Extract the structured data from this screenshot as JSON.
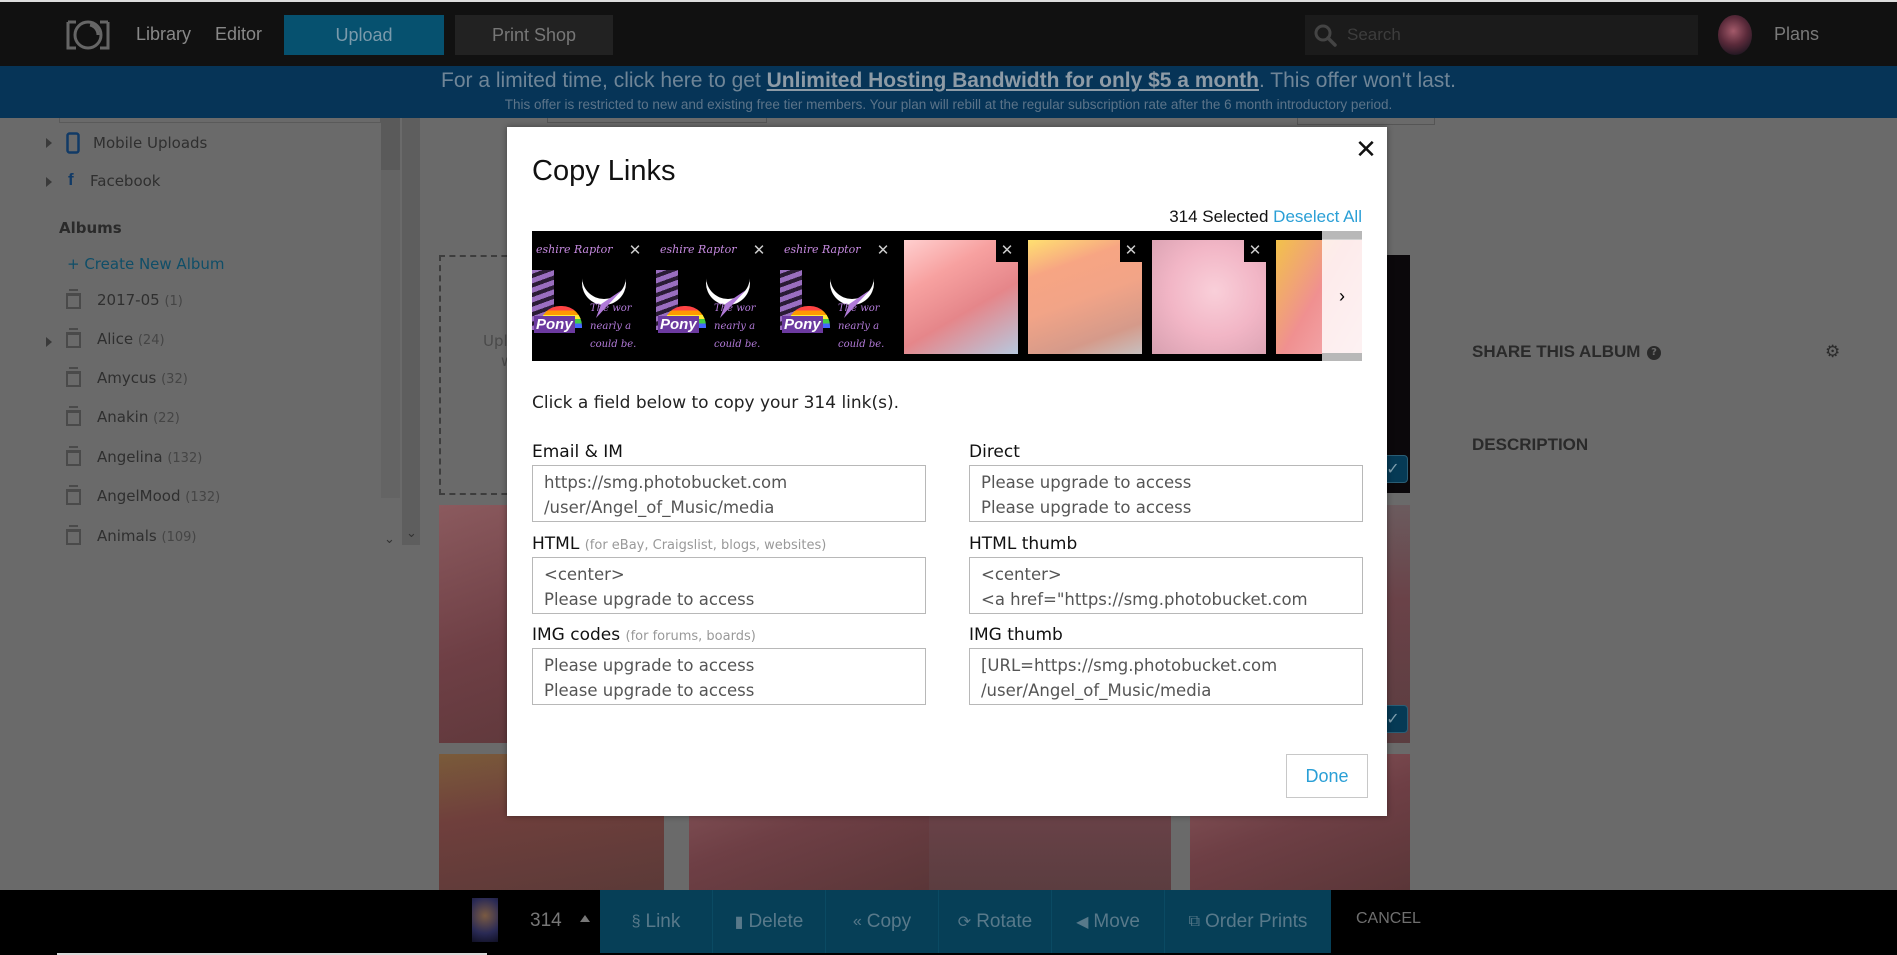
{
  "topnav": {
    "library": "Library",
    "editor": "Editor",
    "upload": "Upload",
    "print_shop": "Print Shop",
    "search_placeholder": "Search",
    "plans": "Plans"
  },
  "banner": {
    "prefix": "For a limited time, click here to get ",
    "link": "Unlimited Hosting Bandwidth for only $5 a month",
    "suffix": ". This offer won't last.",
    "sub": "This offer is restricted to new and existing free tier members. Your plan will rebill at the regular subscription rate after the 6 month introductory period."
  },
  "sidebar": {
    "sources": [
      {
        "label": "Mobile Uploads",
        "icon": "mobile-icon"
      },
      {
        "label": "Facebook",
        "icon": "facebook-icon"
      }
    ],
    "albums_heading": "Albums",
    "create_album": "+ Create New Album",
    "albums": [
      {
        "name": "2017-05",
        "count": "(1)",
        "expandable": false
      },
      {
        "name": "Alice",
        "count": "(24)",
        "expandable": true
      },
      {
        "name": "Amycus",
        "count": "(32)",
        "expandable": false
      },
      {
        "name": "Anakin",
        "count": "(22)",
        "expandable": false
      },
      {
        "name": "Angelina",
        "count": "(132)",
        "expandable": false
      },
      {
        "name": "AngelMood",
        "count": "(132)",
        "expandable": false
      },
      {
        "name": "Animals",
        "count": "(109)",
        "expandable": false
      }
    ]
  },
  "main": {
    "upload_drop_partial": "Upl",
    "upload_drop_partial2": "w",
    "share_album": "SHARE THIS ALBUM",
    "description": "DESCRIPTION",
    "help_glyph": "?",
    "check_glyph": "✓"
  },
  "actionbar": {
    "selected_count": "314",
    "actions": [
      {
        "label": "Link",
        "icon": "link-icon",
        "glyph": "§"
      },
      {
        "label": "Delete",
        "icon": "trash-icon",
        "glyph": "▮"
      },
      {
        "label": "Copy",
        "icon": "copy-icon",
        "glyph": "«"
      },
      {
        "label": "Rotate",
        "icon": "rotate-icon",
        "glyph": "⟳"
      },
      {
        "label": "Move",
        "icon": "move-icon",
        "glyph": "◀"
      },
      {
        "label": "Order Prints",
        "icon": "prints-icon",
        "glyph": "⧉"
      }
    ],
    "cancel": "CANCEL"
  },
  "modal": {
    "title": "Copy Links",
    "close_glyph": "✕",
    "selected_text": "314 Selected",
    "deselect_all": "Deselect All",
    "thumbnails": [
      {
        "kind": "raptor",
        "caption_top": "eshire Raptor",
        "lines": [
          "The wor",
          "nearly a",
          "could be."
        ],
        "badge": "Pony"
      },
      {
        "kind": "raptor",
        "caption_top": "eshire Raptor",
        "lines": [
          "The wor",
          "nearly a",
          "could be."
        ],
        "badge": "Pony"
      },
      {
        "kind": "raptor",
        "caption_top": "eshire Raptor",
        "lines": [
          "The wor",
          "nearly a",
          "could be."
        ],
        "badge": "Pony"
      },
      {
        "kind": "photo",
        "style": "pink1"
      },
      {
        "kind": "photo",
        "style": "pink2"
      },
      {
        "kind": "photo",
        "style": "pink3"
      },
      {
        "kind": "photo",
        "style": "pink4"
      }
    ],
    "remove_glyph": "✕",
    "next_glyph": "›",
    "instructions": "Click a field below to copy your 314 link(s).",
    "fields": [
      {
        "label": "Email & IM",
        "hint": "",
        "lines": [
          "https://smg.photobucket.com",
          "/user/Angel_of_Music/media"
        ]
      },
      {
        "label": "Direct",
        "hint": "",
        "lines": [
          "Please upgrade to access",
          "Please upgrade to access"
        ]
      },
      {
        "label": "HTML",
        "hint": "(for eBay, Craigslist, blogs, websites)",
        "lines": [
          "<center>",
          "Please upgrade to access"
        ]
      },
      {
        "label": "HTML thumb",
        "hint": "",
        "lines": [
          "<center>",
          "<a href=\"https://smg.photobucket.com"
        ]
      },
      {
        "label": "IMG codes",
        "hint": "(for forums, boards)",
        "lines": [
          "Please upgrade to access",
          "Please upgrade to access"
        ]
      },
      {
        "label": "IMG thumb",
        "hint": "",
        "lines": [
          "[URL=https://smg.photobucket.com",
          "/user/Angel_of_Music/media"
        ]
      }
    ],
    "done": "Done"
  },
  "colors": {
    "accent": "#2a9fd6",
    "nav_bg": "#111111",
    "banner_bg": "#063457",
    "action_bar": "#063f57"
  }
}
